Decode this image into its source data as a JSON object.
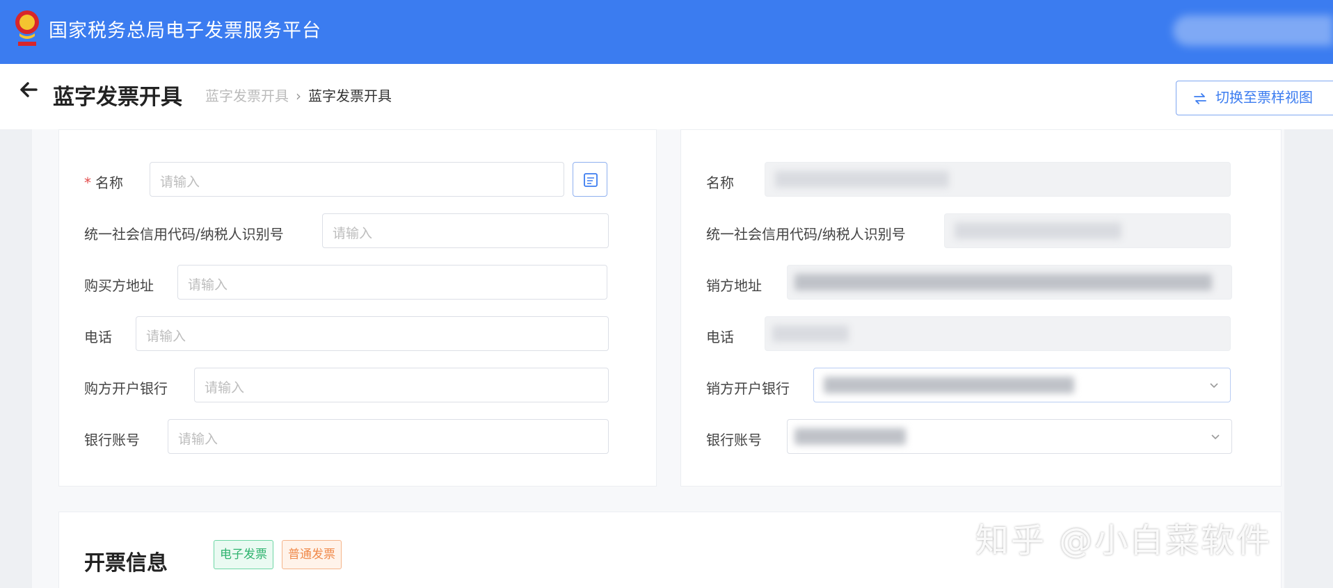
{
  "app": {
    "title": "国家税务总局电子发票服务平台"
  },
  "header": {
    "page_title": "蓝字发票开具",
    "breadcrumb": [
      "蓝字发票开具",
      "蓝字发票开具"
    ],
    "switch_label": "切换至票样视图"
  },
  "buyer": {
    "fields": [
      {
        "label": "名称",
        "required": true,
        "placeholder": "请输入"
      },
      {
        "label": "统一社会信用代码/纳税人识别号",
        "placeholder": "请输入"
      },
      {
        "label": "购买方地址",
        "placeholder": "请输入"
      },
      {
        "label": "电话",
        "placeholder": "请输入"
      },
      {
        "label": "购方开户银行",
        "placeholder": "请输入"
      },
      {
        "label": "银行账号",
        "placeholder": "请输入"
      }
    ]
  },
  "seller": {
    "fields": [
      {
        "label": "名称"
      },
      {
        "label": "统一社会信用代码/纳税人识别号"
      },
      {
        "label": "销方地址"
      },
      {
        "label": "电话"
      },
      {
        "label": "销方开户银行"
      },
      {
        "label": "银行账号"
      }
    ]
  },
  "invoice_info": {
    "title": "开票信息",
    "tags": [
      "电子发票",
      "普通发票"
    ]
  },
  "watermark": "知乎 @小白菜软件",
  "colors": {
    "brand": "#3b7cf0",
    "required": "#e34d4d",
    "tag_green": "#2fb36f",
    "tag_orange": "#f08a4b"
  },
  "icons": [
    "emblem-icon",
    "back-arrow-icon",
    "swap-icon",
    "book-icon",
    "chevron-down-icon"
  ]
}
